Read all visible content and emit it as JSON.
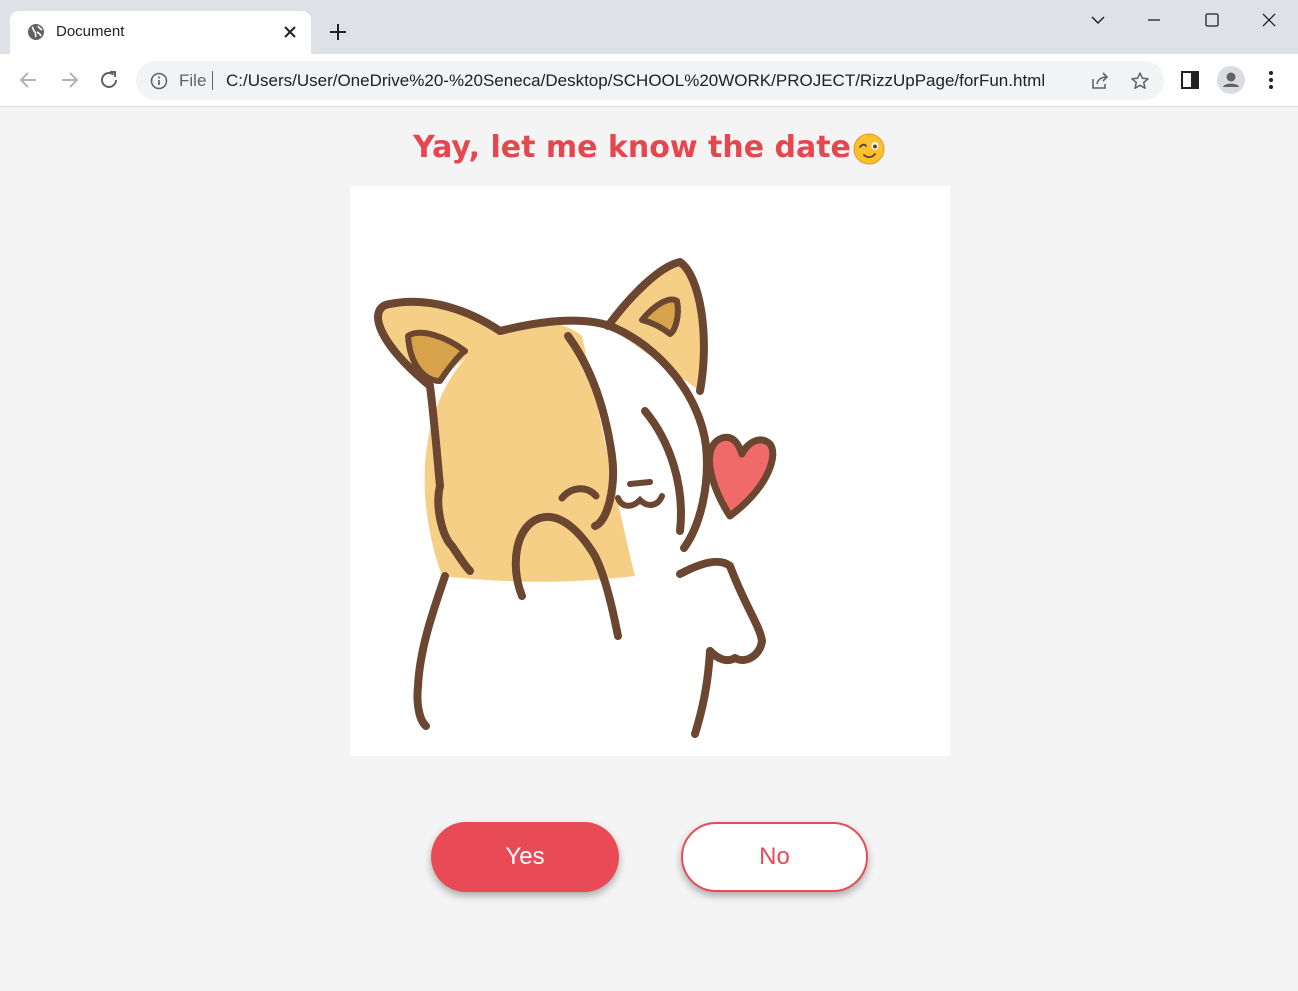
{
  "browser": {
    "tab_title": "Document",
    "file_label": "File",
    "url": "C:/Users/User/OneDrive%20-%20Seneca/Desktop/SCHOOL%20WORK/PROJECT/RizzUpPage/forFun.html",
    "icons": [
      "globe-icon",
      "close-icon",
      "plus-icon",
      "chevron-down-icon",
      "minimize-icon",
      "maximize-icon",
      "close-window-icon",
      "back-icon",
      "forward-icon",
      "reload-icon",
      "info-icon",
      "share-icon",
      "star-icon",
      "side-panel-icon",
      "profile-icon",
      "more-icon"
    ]
  },
  "page": {
    "heading": "Yay, let me know the date",
    "heading_emoji": "winking-face-icon",
    "image": "corgi-blowing-heart-illustration",
    "yes_label": "Yes",
    "no_label": "No",
    "colors": {
      "accent": "#e94b56",
      "heading": "#e5474f",
      "background": "#f4f4f4"
    }
  }
}
